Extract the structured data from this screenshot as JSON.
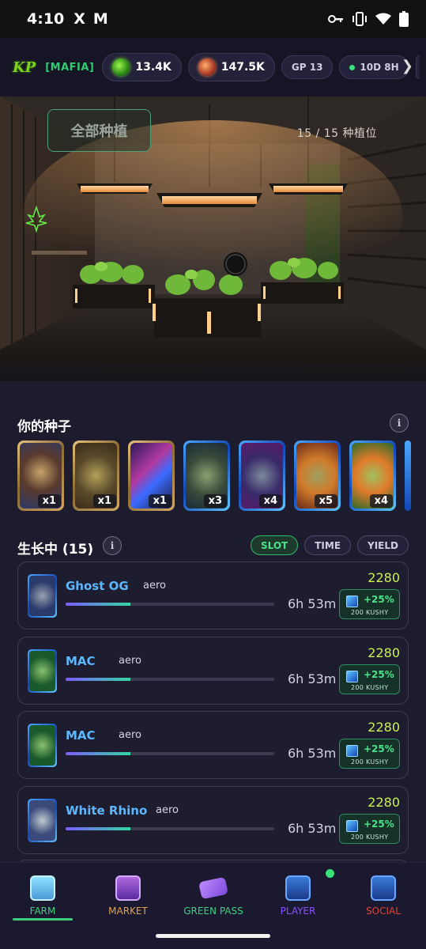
{
  "status_bar": {
    "time": "4:10",
    "x_icon": "X",
    "m_icon": "M"
  },
  "header": {
    "logo": "KP",
    "clan_tag": "[MAFIA]",
    "green_coins": "13.4K",
    "kushy_coins": "147.5K",
    "gp_level": "GP 13",
    "timer": "10D 8H"
  },
  "grow_room": {
    "plant_all_label": "全部种植",
    "slots_label": "15 / 15 种植位"
  },
  "seeds_section": {
    "title": "你的种子",
    "seeds": [
      {
        "rarity": "gold",
        "qty": "x1"
      },
      {
        "rarity": "gold",
        "qty": "x1"
      },
      {
        "rarity": "gold",
        "qty": "x1"
      },
      {
        "rarity": "blue",
        "qty": "x3"
      },
      {
        "rarity": "blue",
        "qty": "x4"
      },
      {
        "rarity": "blue",
        "qty": "x5"
      },
      {
        "rarity": "blue",
        "qty": "x4"
      }
    ]
  },
  "growing_section": {
    "title": "生长中 (15)",
    "sort_tabs": [
      "SLOT",
      "TIME",
      "YIELD"
    ],
    "active_sort": "SLOT",
    "plants": [
      {
        "name": "Ghost OG",
        "owner": "aero",
        "time_left": "6h 53m",
        "yield": "2280",
        "boost_pct": "+25%",
        "boost_amount": "200 KUSHY",
        "progress": 0.31
      },
      {
        "name": "MAC",
        "owner": "aero",
        "time_left": "6h 53m",
        "yield": "2280",
        "boost_pct": "+25%",
        "boost_amount": "200 KUSHY",
        "progress": 0.31
      },
      {
        "name": "MAC",
        "owner": "aero",
        "time_left": "6h 53m",
        "yield": "2280",
        "boost_pct": "+25%",
        "boost_amount": "200 KUSHY",
        "progress": 0.31
      },
      {
        "name": "White Rhino",
        "owner": "aero",
        "time_left": "6h 53m",
        "yield": "2280",
        "boost_pct": "+25%",
        "boost_amount": "200 KUSHY",
        "progress": 0.31
      }
    ]
  },
  "bottom_nav": {
    "items": [
      {
        "label": "FARM",
        "color": "#3ecf7d",
        "icon": "farm-icon"
      },
      {
        "label": "MARKET",
        "color": "#e2a14a",
        "icon": "market-icon"
      },
      {
        "label": "GREEN PASS",
        "color": "#3ecf7d",
        "icon": "green-pass-icon"
      },
      {
        "label": "PLAYER",
        "color": "#8a4fff",
        "icon": "player-icon"
      },
      {
        "label": "SOCIAL",
        "color": "#e0443a",
        "icon": "social-icon"
      }
    ],
    "active": "FARM"
  },
  "colors": {
    "accent_green": "#3ecf7d",
    "yield_color": "#c8f24e",
    "name_blue": "#5db7ff"
  }
}
